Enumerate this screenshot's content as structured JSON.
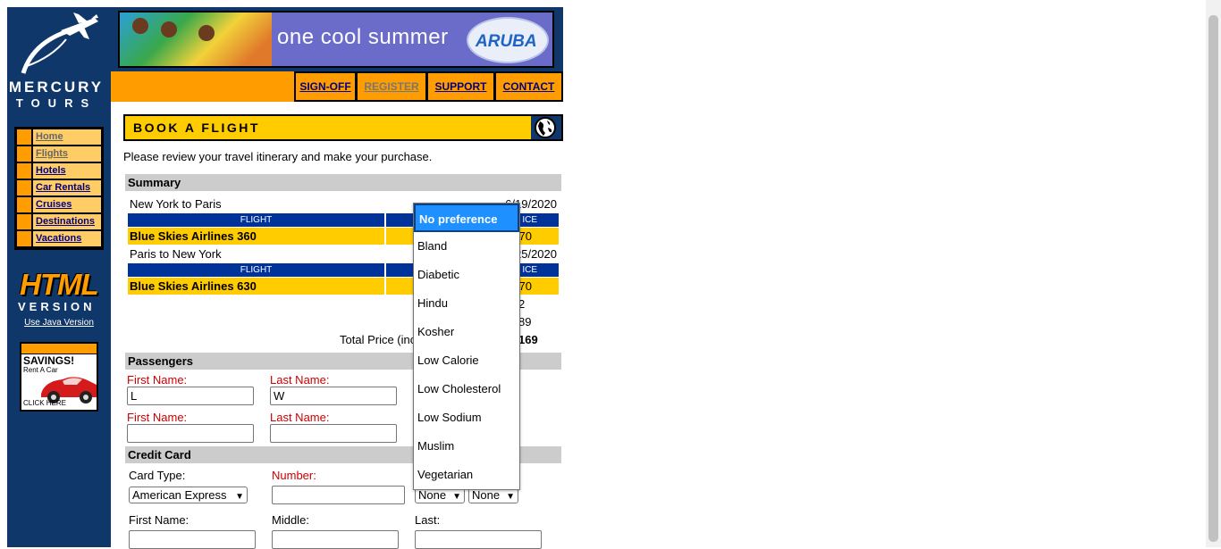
{
  "brand": {
    "line1": "MERCURY",
    "line2": "TOURS",
    "logo_icon": "airplane-icon"
  },
  "banner": {
    "text": "one cool summer",
    "badge": "ARUBA"
  },
  "top_nav": [
    {
      "label": "SIGN-OFF"
    },
    {
      "label": "REGISTER"
    },
    {
      "label": "SUPPORT"
    },
    {
      "label": "CONTACT"
    }
  ],
  "side_nav": [
    {
      "label": "Home"
    },
    {
      "label": "Flights"
    },
    {
      "label": "Hotels"
    },
    {
      "label": "Car Rentals"
    },
    {
      "label": "Cruises"
    },
    {
      "label": "Destinations"
    },
    {
      "label": "Vacations"
    }
  ],
  "html_version": {
    "big": "HTML",
    "sub": "VERSION",
    "java_link": "Use Java Version"
  },
  "savings_ad": {
    "title": "SAVINGS!",
    "sub": "Rent A Car",
    "cta": "CLICK HERE"
  },
  "page": {
    "header": "BOOK A FLIGHT",
    "intro": "Please review your travel itinerary and make your purchase."
  },
  "summary": {
    "title": "Summary",
    "legs": [
      {
        "route": "New York to Paris",
        "date": "6/19/2020",
        "col_flight": "FLIGHT",
        "col_price": "ICE",
        "flight": "Blue Skies Airlines 360",
        "price": "70"
      },
      {
        "route": "Paris to New York",
        "date": "/25/2020",
        "col_flight": "FLIGHT",
        "col_price": "ICE",
        "flight": "Blue Skies Airlines 630",
        "price": "70"
      }
    ],
    "passengers_count": "2",
    "taxes": "89",
    "total_label": "Total Price (inc",
    "total_value": "169"
  },
  "passengers": {
    "title": "Passengers",
    "first_label": "First Name:",
    "last_label": "Last Name:",
    "p1_first": "L",
    "p1_last": "W",
    "p2_first": "",
    "p2_last": ""
  },
  "credit_card": {
    "title": "Credit Card",
    "type_label": "Card Type:",
    "type_value": "American Express",
    "number_label": "Number:",
    "exp_month": "None",
    "exp_year": "None",
    "first_label": "First Name:",
    "middle_label": "Middle:",
    "last_label": "Last:"
  },
  "meal_dropdown": {
    "options": [
      "No preference",
      "Bland",
      "Diabetic",
      "Hindu",
      "Kosher",
      "Low Calorie",
      "Low Cholesterol",
      "Low Sodium",
      "Muslim",
      "Vegetarian"
    ],
    "selected": "No preference"
  },
  "colors": {
    "navy": "#0f3769",
    "orange": "#ff9c00",
    "yellow": "#ffcc00",
    "table_blue": "#003399",
    "highlight": "#1e90ff"
  }
}
